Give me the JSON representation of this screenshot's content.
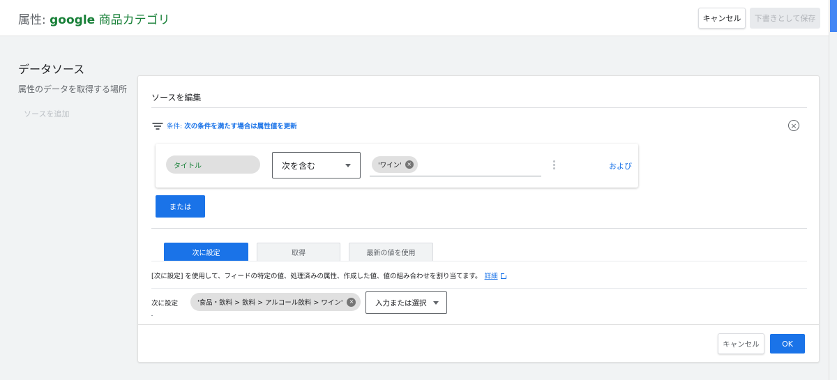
{
  "header": {
    "title_prefix": "属性: ",
    "title_brand": "google",
    "title_rest": " 商品カテゴリ",
    "cancel_label": "キャンセル",
    "save_draft_label": "下書きとして保存"
  },
  "left": {
    "section_title": "データソース",
    "section_subtitle": "属性のデータを取得する場所",
    "add_source_label": "ソースを追加"
  },
  "card": {
    "title": "ソースを編集",
    "condition": {
      "prefix": "条件: ",
      "text": "次の条件を満たす場合は属性値を更新"
    },
    "rule": {
      "attribute_chip": "タイトル",
      "operator": "次を含む",
      "value_chip": "'ワイン'",
      "and_label": "および"
    },
    "or_button": "または",
    "tabs": [
      {
        "label": "次に設定",
        "active": true
      },
      {
        "label": "取得",
        "active": false
      },
      {
        "label": "最新の値を使用",
        "active": false
      }
    ],
    "description": "[次に設定] を使用して、フィードの特定の値、処理済みの属性、作成した値、値の組み合わせを割り当てます。",
    "details_link": "詳細",
    "set_to": {
      "label": "次に設定",
      "value_chip": "'食品・飲料 > 飲料 > アルコール飲料 > ワイン'",
      "picker_placeholder": "入力または選択"
    },
    "footer": {
      "cancel_label": "キャンセル",
      "ok_label": "OK"
    }
  },
  "colors": {
    "accent": "#1a73e8",
    "brand_green": "#188038"
  },
  "icons": {
    "filter": "filter-icon",
    "close": "close-circle-icon",
    "remove_chip": "remove-chip-icon",
    "more": "more-vert-icon",
    "external_link": "open-in-new-icon",
    "dropdown": "arrow-drop-down-icon"
  }
}
